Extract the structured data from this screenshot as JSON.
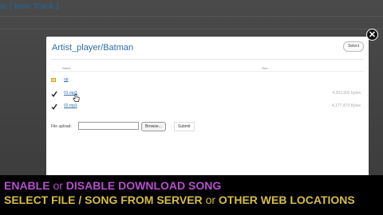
{
  "background": {
    "title": "se",
    "new_track_link": "[ New Track ]"
  },
  "dialog": {
    "title": "Artist_player/Batman",
    "select_button": "Select",
    "columns": {
      "name": "Name",
      "size": "Size"
    },
    "rows": [
      {
        "type": "folder",
        "name": "up",
        "size": ""
      },
      {
        "type": "file",
        "name": "01.mp3",
        "size": "4,203,902 bytes"
      },
      {
        "type": "file",
        "name": "02.mp3",
        "size": "4,177,473 Bytes"
      }
    ],
    "upload": {
      "label": "File upload:",
      "value": "",
      "browse_label": "Browse...",
      "submit_label": "Submit"
    },
    "close_glyph": "✕"
  },
  "caption": {
    "line1": {
      "a": "ENABLE",
      "b": "or",
      "c": "DISABLE DOWNLOAD SONG"
    },
    "line2": {
      "a": "SELECT FILE / SONG FROM SERVER",
      "b": "or",
      "c": "OTHER WEB LOCATIONS"
    }
  },
  "colors": {
    "caption_line1": "#b64ed0",
    "caption_line2": "#d5bd47",
    "link_blue": "#2d6ea8"
  },
  "icons": {
    "check": "check-icon",
    "folder": "folder-icon",
    "close": "close-icon",
    "cursor": "hand-cursor-icon"
  }
}
